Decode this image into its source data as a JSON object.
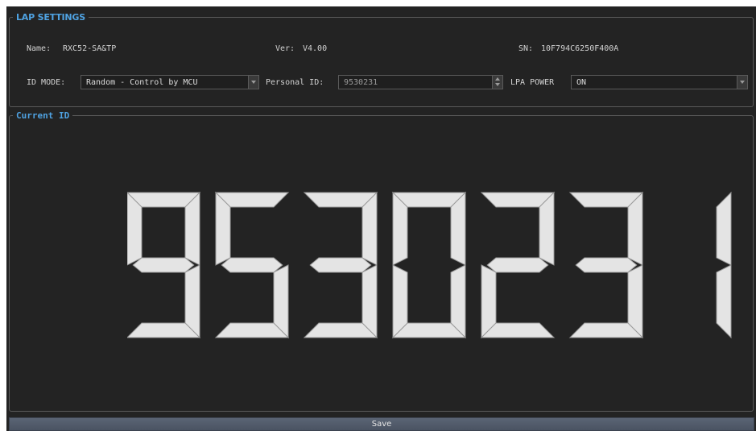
{
  "lap_settings": {
    "title": "LAP SETTINGS",
    "name_label": "Name:",
    "name_value": "RXC52-SA&TP",
    "ver_label": "Ver:",
    "ver_value": "V4.00",
    "sn_label": "SN:",
    "sn_value": "10F794C6250F400A",
    "id_mode_label": "ID MODE:",
    "id_mode_value": "Random - Control by MCU",
    "personal_id_label": "Personal ID:",
    "personal_id_value": "9530231",
    "lpa_power_label": "LPA POWER",
    "lpa_power_value": "ON"
  },
  "current_id": {
    "title": "Current ID",
    "digits": "9530231"
  },
  "save_label": "Save",
  "colors": {
    "background": "#232323",
    "accent": "#4fa3e3",
    "segment": "#e4e4e4"
  }
}
